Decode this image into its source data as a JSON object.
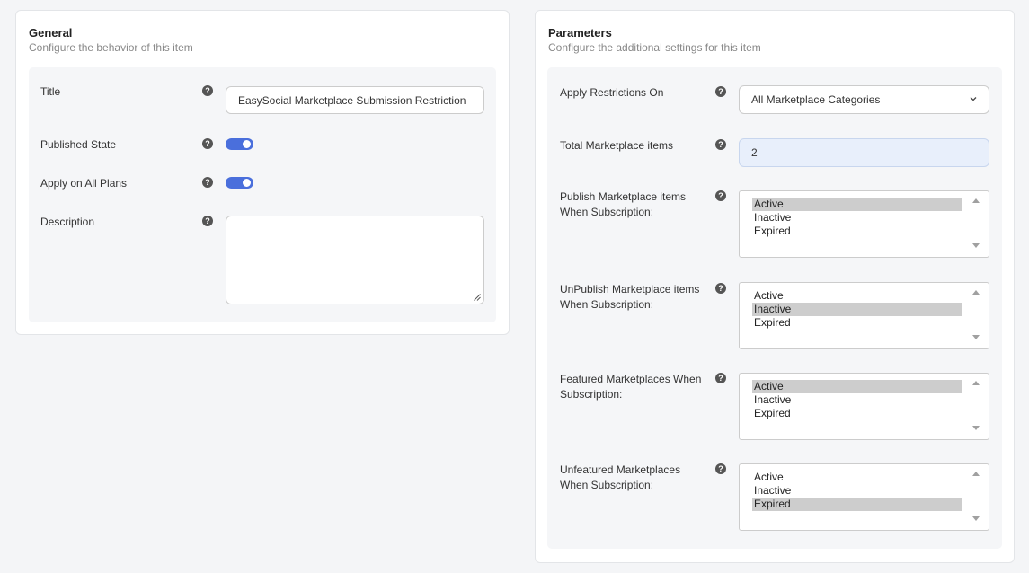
{
  "general": {
    "title": "General",
    "subtitle": "Configure the behavior of this item",
    "fields": {
      "title_label": "Title",
      "title_value": "EasySocial Marketplace Submission Restriction",
      "published_label": "Published State",
      "published_on": true,
      "all_plans_label": "Apply on All Plans",
      "all_plans_on": true,
      "description_label": "Description",
      "description_value": ""
    }
  },
  "parameters": {
    "title": "Parameters",
    "subtitle": "Configure the additional settings for this item",
    "apply_on_label": "Apply Restrictions On",
    "apply_on_value": "All Marketplace Categories",
    "total_label": "Total Marketplace items",
    "total_value": "2",
    "lists": [
      {
        "label1": "Publish Marketplace items",
        "label2": "When Subscription:",
        "options": [
          "Active",
          "Inactive",
          "Expired"
        ],
        "selected": 0
      },
      {
        "label1": "UnPublish Marketplace items",
        "label2": "When Subscription:",
        "options": [
          "Active",
          "Inactive",
          "Expired"
        ],
        "selected": 1
      },
      {
        "label1": "Featured Marketplaces When",
        "label2": "Subscription:",
        "options": [
          "Active",
          "Inactive",
          "Expired"
        ],
        "selected": 0
      },
      {
        "label1": "Unfeatured Marketplaces",
        "label2": "When Subscription:",
        "options": [
          "Active",
          "Inactive",
          "Expired"
        ],
        "selected": 2
      }
    ]
  },
  "icons": {
    "help": "?",
    "help_icon_name": "question-circle-icon",
    "chevron_icon_name": "chevron-down-icon"
  },
  "colors": {
    "toggle_on": "#4a6fdc",
    "selected_option": "#cdcdcd",
    "number_field_bg": "#e8effb"
  }
}
